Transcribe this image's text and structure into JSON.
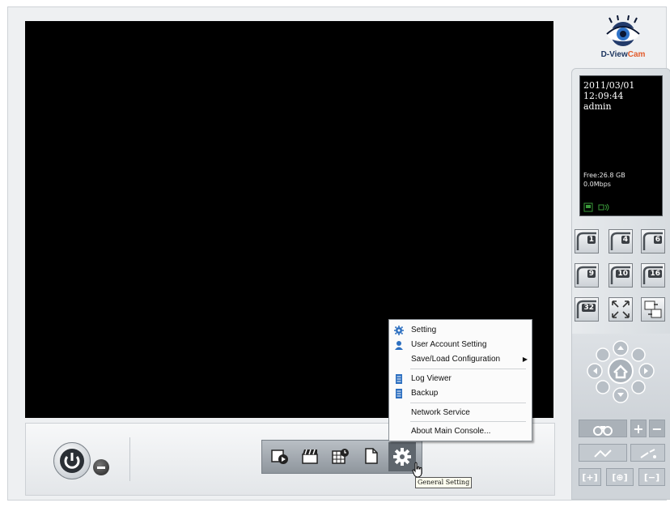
{
  "brand": {
    "name_prefix": "D-View",
    "name_suffix": "Cam"
  },
  "status": {
    "date": "2011/03/01",
    "time": "12:09:44",
    "user": "admin",
    "free": "Free:26.8 GB",
    "bandwidth": "0.0Mbps"
  },
  "layout_buttons": [
    {
      "label": "1",
      "icon": "single-view-icon"
    },
    {
      "label": "4",
      "icon": "quad-view-icon"
    },
    {
      "label": "6",
      "icon": "six-view-icon"
    },
    {
      "label": "9",
      "icon": "nine-view-icon"
    },
    {
      "label": "10",
      "icon": "ten-view-icon"
    },
    {
      "label": "16",
      "icon": "sixteen-view-icon"
    },
    {
      "label": "32",
      "icon": "thirtytwo-view-icon"
    },
    {
      "label": "",
      "icon": "fullscreen-icon"
    },
    {
      "label": "",
      "icon": "swap-view-icon"
    }
  ],
  "menu": {
    "items": [
      {
        "label": "Setting",
        "icon": "gear-icon"
      },
      {
        "label": "User Account Setting",
        "icon": "user-icon"
      },
      {
        "label": "Save/Load Configuration",
        "icon": "",
        "submenu": true
      },
      {
        "label": "Log Viewer",
        "icon": "log-icon"
      },
      {
        "label": "Backup",
        "icon": "backup-icon"
      },
      {
        "label": "Network Service",
        "icon": ""
      },
      {
        "label": "About Main Console...",
        "icon": ""
      }
    ]
  },
  "toolbar": {
    "buttons": [
      {
        "icon": "playback-icon"
      },
      {
        "icon": "clapper-icon"
      },
      {
        "icon": "schedule-icon"
      },
      {
        "icon": "document-icon"
      },
      {
        "icon": "gear-icon"
      }
    ]
  },
  "tooltip": "General Setting",
  "zoom": {
    "plus": "+",
    "minus": "−"
  },
  "colors": {
    "accent": "#e25b2c",
    "brand": "#1d3660"
  }
}
